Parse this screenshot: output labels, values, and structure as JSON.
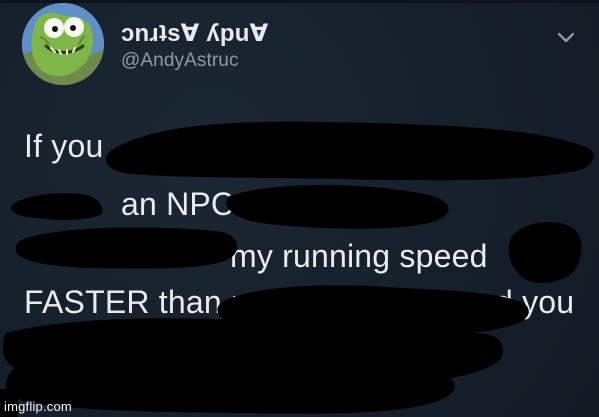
{
  "header": {
    "display_name": "ɔnɹʇsⱯ ʎpuⱯ",
    "handle": "@AndyAstruc",
    "avatar_icon": "fish-cartoon-avatar",
    "menu_icon": "chevron-down-icon"
  },
  "tweet": {
    "lines": [
      "If you",
      "an NPC",
      "my running speed",
      "FASTER than r",
      "d you"
    ]
  },
  "watermark": "imgflip.com",
  "colors": {
    "background": "#16202b",
    "text": "#e8ecef",
    "handle": "#8d99a4",
    "redaction": "#000000"
  }
}
